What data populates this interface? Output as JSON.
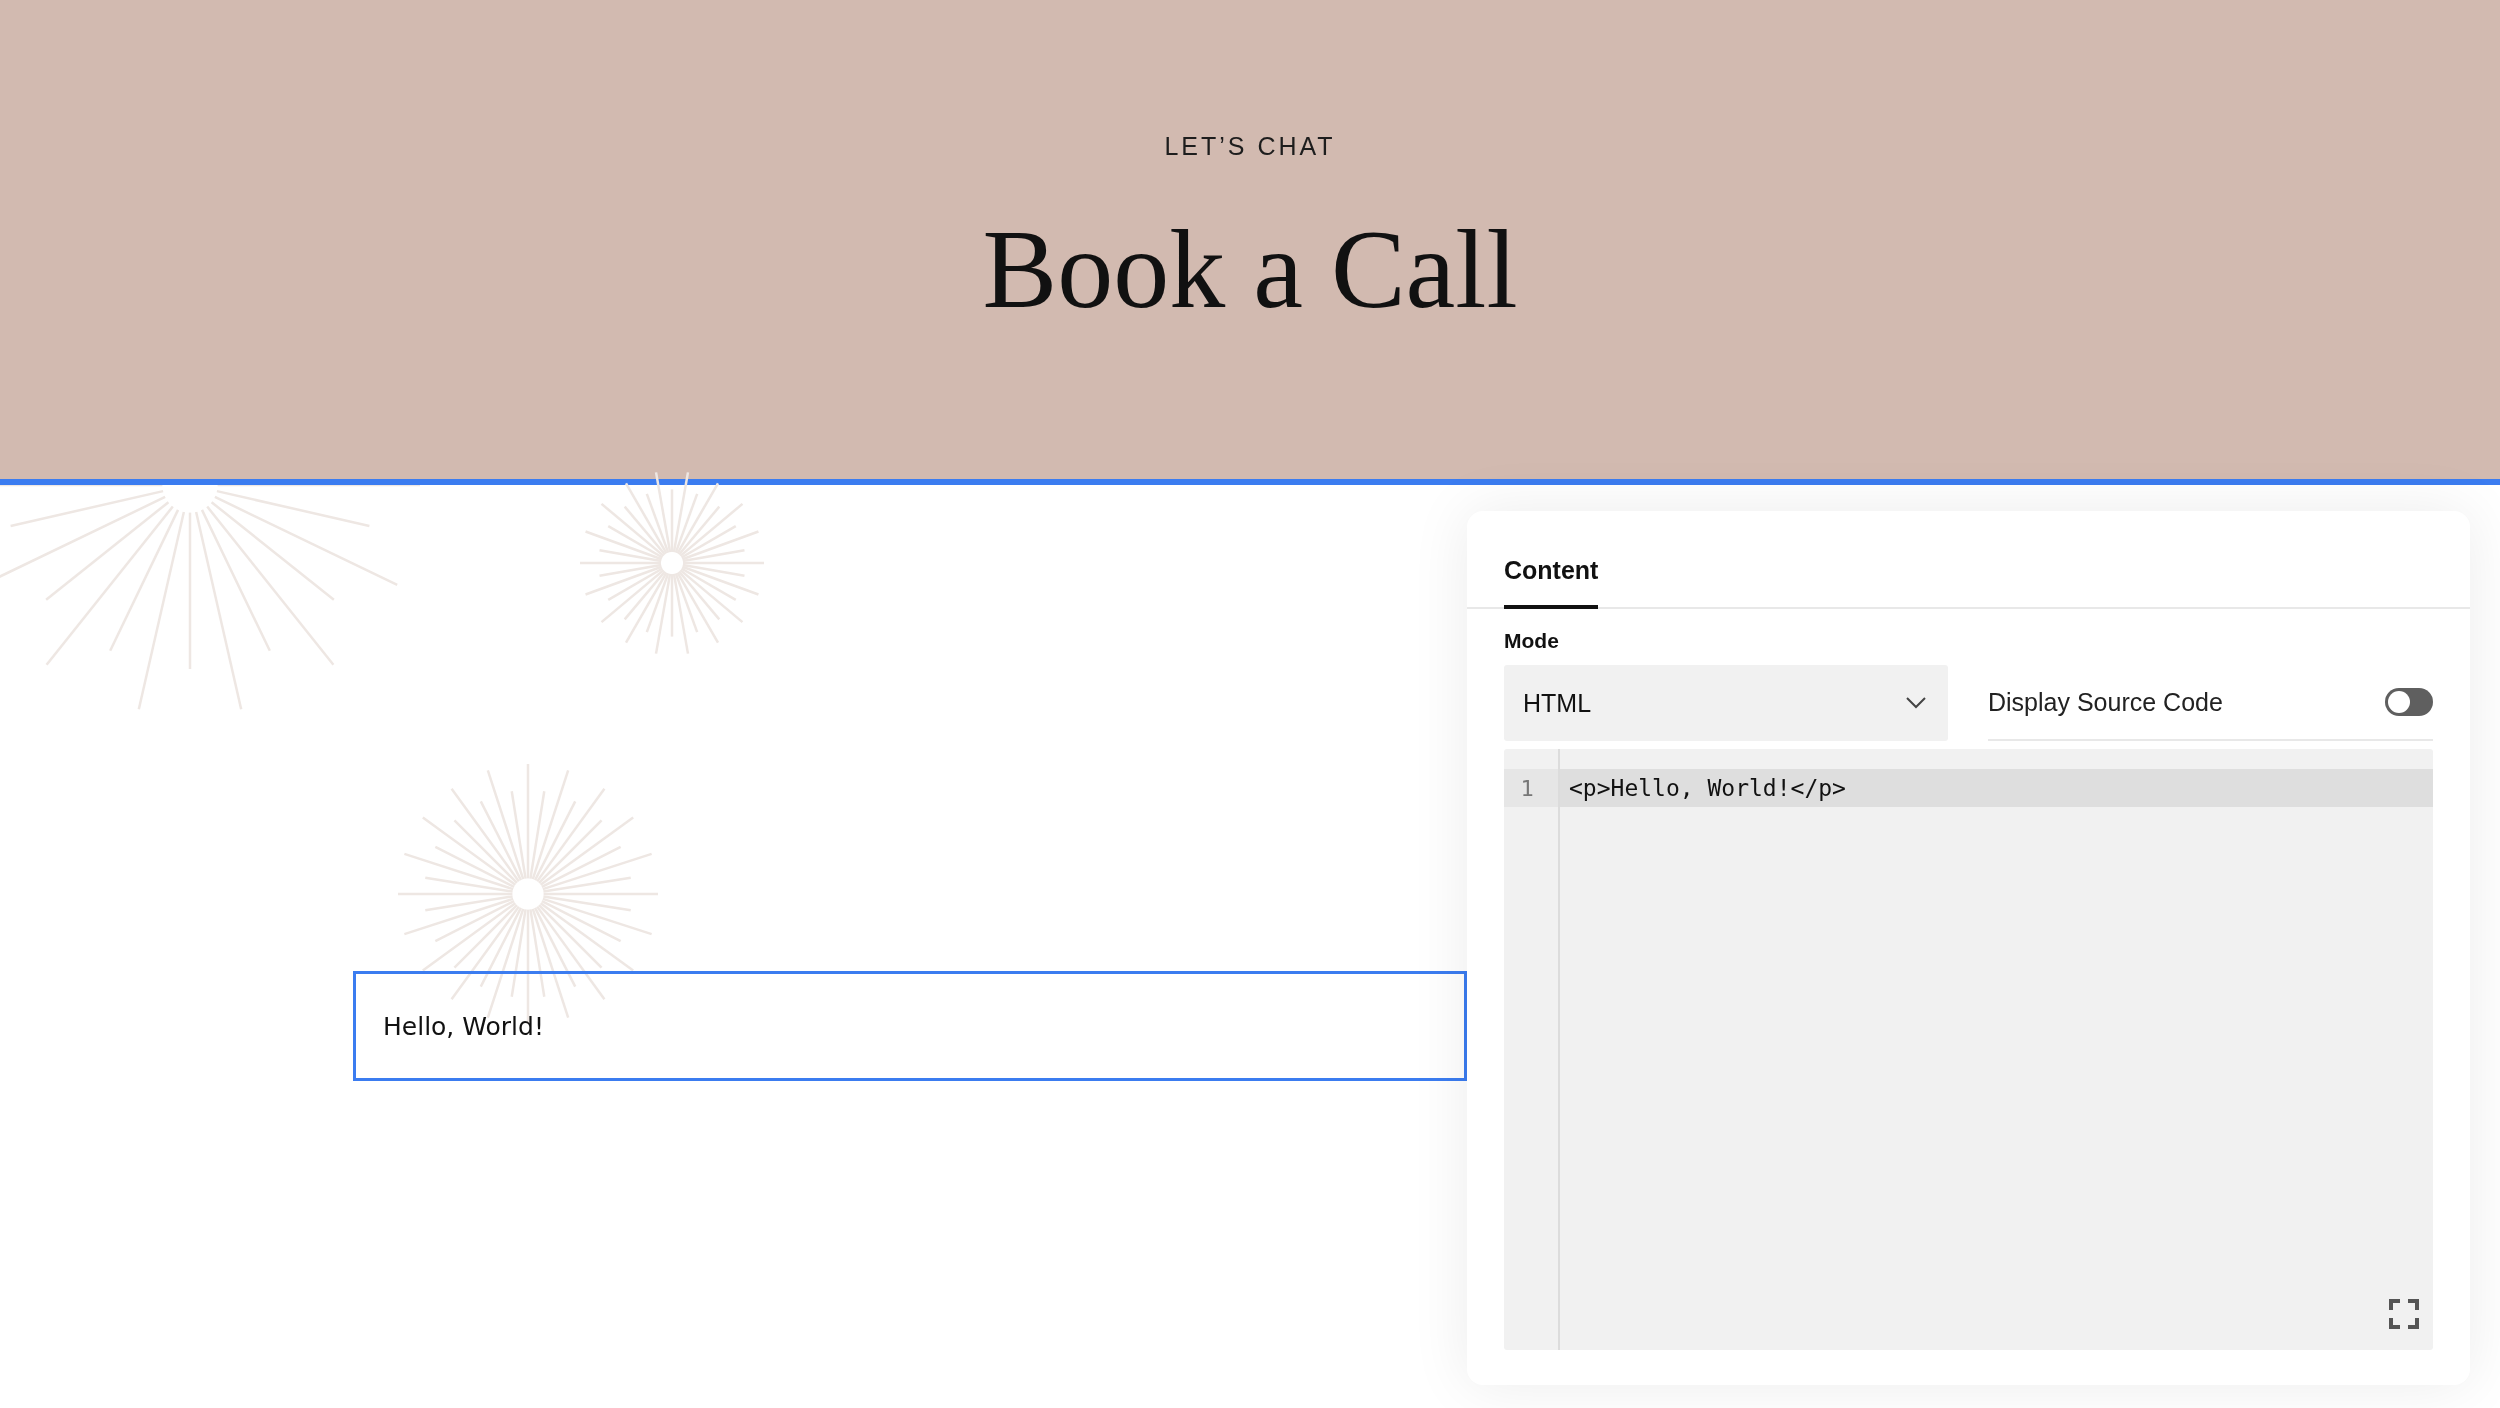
{
  "header": {
    "eyebrow": "LET’S CHAT",
    "title": "Book a Call"
  },
  "text_block": {
    "text": "Hello, World!",
    "selected": true
  },
  "panel": {
    "tabs": [
      {
        "label": "Content",
        "selected": true
      }
    ],
    "mode": {
      "label": "Mode",
      "value": "HTML"
    },
    "display_source_code": {
      "label": "Display Source Code",
      "on": false
    },
    "editor": {
      "lines": [
        {
          "number": "1",
          "code": "<p>Hello, World!</p>",
          "active": true
        }
      ]
    }
  }
}
